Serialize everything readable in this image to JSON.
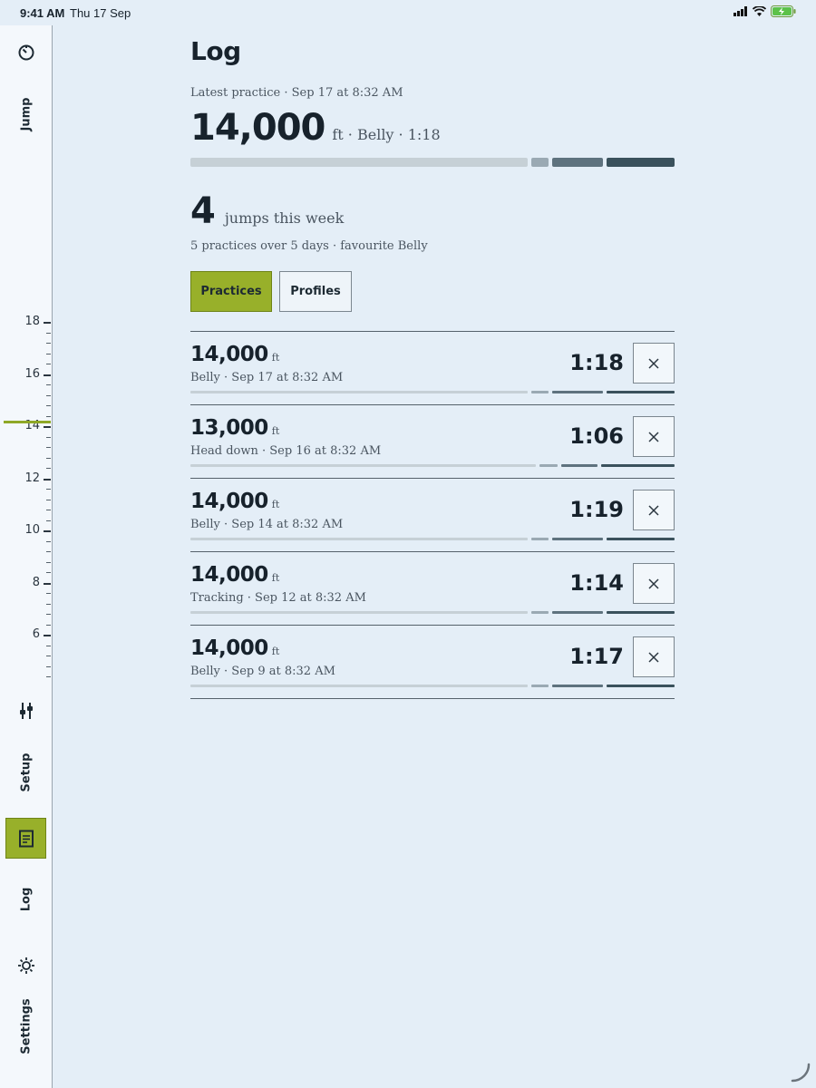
{
  "status": {
    "time": "9:41 AM",
    "date": "Thu 17 Sep"
  },
  "sidebar": {
    "jump_label": "Jump",
    "setup_label": "Setup",
    "log_label": "Log",
    "settings_label": "Settings",
    "ruler_labels": [
      "18",
      "16",
      "14",
      "12",
      "10",
      "8",
      "6"
    ],
    "ruler_current": 14.2
  },
  "header": {
    "title": "Log",
    "latest": "Latest practice · Sep 17 at 8:32 AM",
    "altitude": "14,000",
    "altitude_meta": "ft · Belly · 1:18"
  },
  "week": {
    "count": "4",
    "text": "jumps this week",
    "subtext": "5 practices over 5 days · favourite Belly"
  },
  "tabs": [
    {
      "label": "Practices",
      "active": true
    },
    {
      "label": "Profiles",
      "active": false
    }
  ],
  "practices": [
    {
      "altitude": "14,000",
      "unit": "ft",
      "meta": "Belly · Sep 17 at 8:32 AM",
      "duration": "1:18"
    },
    {
      "altitude": "13,000",
      "unit": "ft",
      "meta": "Head down · Sep 16 at 8:32 AM",
      "duration": "1:06"
    },
    {
      "altitude": "14,000",
      "unit": "ft",
      "meta": "Belly · Sep 14 at 8:32 AM",
      "duration": "1:19"
    },
    {
      "altitude": "14,000",
      "unit": "ft",
      "meta": "Tracking · Sep 12 at 8:32 AM",
      "duration": "1:14"
    },
    {
      "altitude": "14,000",
      "unit": "ft",
      "meta": "Belly · Sep 9 at 8:32 AM",
      "duration": "1:17"
    }
  ],
  "colors": {
    "accent": "#98b02a",
    "seg1": "#c6d0d6",
    "seg2": "#9aa9b3",
    "seg3": "#5e727e",
    "seg4": "#3a515c"
  }
}
